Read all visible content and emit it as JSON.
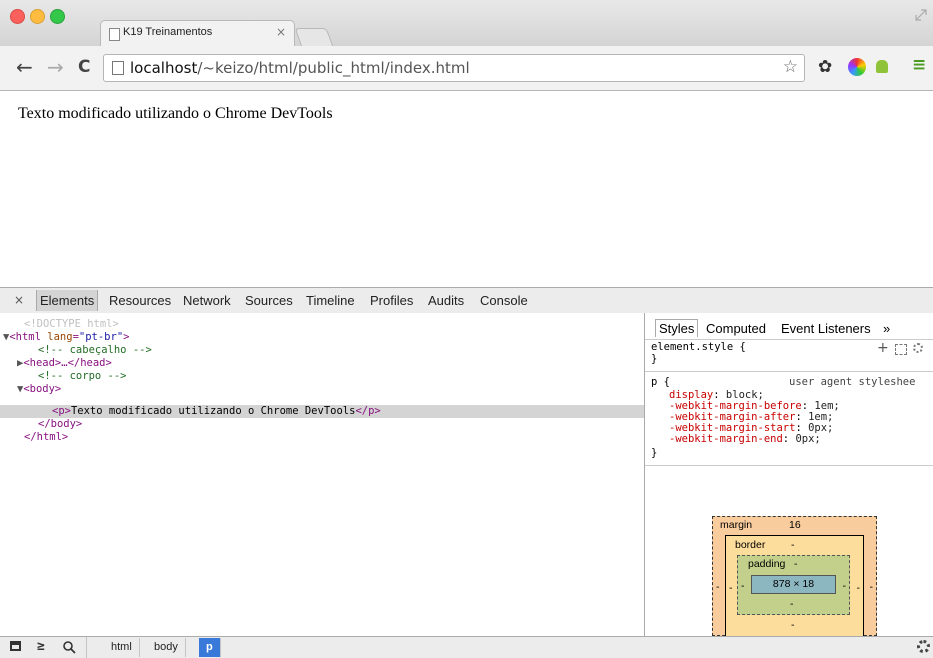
{
  "tab": {
    "title": "K19 Treinamentos",
    "close": "×"
  },
  "toolbar": {
    "back": "←",
    "forward": "→",
    "reload": "C",
    "url_host": "localhost",
    "url_path": "/~keizo/html/public_html/index.html",
    "star": "☆",
    "gear": "✿",
    "menu": "≡"
  },
  "page": {
    "text": "Texto modificado utilizando o Chrome DevTools"
  },
  "devtools": {
    "close": "×",
    "tabs": [
      "Elements",
      "Resources",
      "Network",
      "Sources",
      "Timeline",
      "Profiles",
      "Audits",
      "Console"
    ],
    "dom": [
      {
        "kind": "doctype",
        "text": "<!DOCTYPE html>"
      },
      {
        "kind": "open",
        "tri": "▼",
        "tag": "<html",
        "attr": "lang",
        "val": "\"pt-br\"",
        "end": ">"
      },
      {
        "kind": "comment",
        "text": "<!-- cabeçalho -->"
      },
      {
        "kind": "collapsed",
        "tri": "▶",
        "text": "<head>…</head>"
      },
      {
        "kind": "comment",
        "text": "<!-- corpo -->"
      },
      {
        "kind": "tag",
        "tri": "▼",
        "text": "<body>"
      },
      {
        "kind": "selected",
        "open": "<p>",
        "text": "Texto modificado utilizando o Chrome DevTools",
        "close": "</p>"
      },
      {
        "kind": "tag",
        "text": "</body>"
      },
      {
        "kind": "tag",
        "text": "</html>"
      }
    ],
    "side_tabs": [
      "Styles",
      "Computed",
      "Event Listeners",
      "»"
    ],
    "element_style": {
      "selector": "element.style {",
      "close": "}",
      "plus": "+"
    },
    "rule": {
      "selector": "p {",
      "origin": "user agent styleshee",
      "props": [
        {
          "name": "display",
          "value": "block;"
        },
        {
          "name": "-webkit-margin-before",
          "value": "1em;"
        },
        {
          "name": "-webkit-margin-after",
          "value": "1em;"
        },
        {
          "name": "-webkit-margin-start",
          "value": "0px;"
        },
        {
          "name": "-webkit-margin-end",
          "value": "0px;"
        }
      ],
      "close": "}"
    },
    "box_model": {
      "margin_label": "margin",
      "margin_top": "16",
      "border_label": "border",
      "border_top": "-",
      "padding_label": "padding",
      "padding_top": "-",
      "content": "878 × 18",
      "dash": "-"
    },
    "breadcrumbs": [
      "html",
      "body",
      "p"
    ]
  },
  "colors": {
    "close_red": "#fc605c",
    "minimize_yellow": "#fdbc40",
    "zoom_green": "#34c84a",
    "crumb_active": "#3879d9",
    "margin_fill": "#f9cc9d",
    "padding_fill": "#c3d08b",
    "content_fill": "#8cb6c0"
  }
}
